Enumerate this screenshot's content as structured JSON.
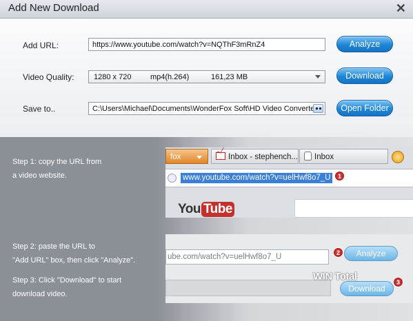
{
  "window": {
    "title": "Add New Download",
    "close_glyph": "✕"
  },
  "form": {
    "url_label": "Add URL:",
    "url_value": "https://www.youtube.com/watch?v=NQThF3mRnZ4",
    "quality_label": "Video Quality:",
    "quality": {
      "resolution": "1280 x 720",
      "format": "mp4(h.264)",
      "size": "161,23 MB"
    },
    "save_label": "Save to..",
    "save_path": "C:\\Users\\Michael\\Documents\\WonderFox Soft\\HD Video Converter",
    "analyze_label": "Analyze",
    "download_label": "Download",
    "open_folder_label": "Open Folder",
    "button_color": "#1e86d6"
  },
  "steps": {
    "step1_line1": "Step 1: copy the URL from",
    "step1_line2": "a video website.",
    "step2_line1": "Step 2: paste the URL to",
    "step2_line2": "\"Add URL\" box, then click \"Analyze\".",
    "step3_line1": "Step 3: Click \"Download\" to start",
    "step3_line2": "download video."
  },
  "illustration": {
    "tab_firefox": "fox",
    "tab_inbox1": "Inbox - stephench...",
    "tab_inbox2": "Inbox",
    "url_text": "www.youtube.com/watch?v=uelHwf8o7_U",
    "yt_you": "You",
    "yt_tube": "Tube",
    "field_text": "ube.com/watch?v=uelHwf8o7_U",
    "analyze_label": "Analyze",
    "download_label": "Download",
    "watermark": "WIN Total",
    "badge1": "1",
    "badge2": "2",
    "badge3": "3",
    "badge_color": "#c01818"
  }
}
